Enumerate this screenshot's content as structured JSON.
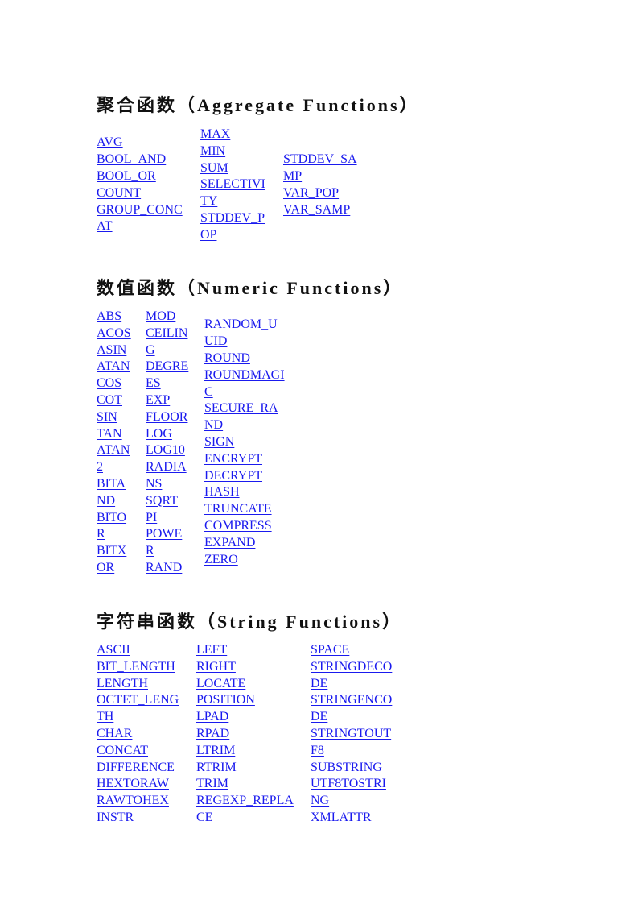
{
  "sections": [
    {
      "title": "聚合函数（Aggregate Functions）",
      "columns": [
        [
          "AVG",
          "BOOL_AND",
          "BOOL_OR",
          "COUNT",
          "GROUP_CONC",
          "AT"
        ],
        [
          "MAX",
          "MIN",
          "SUM",
          "SELECTIVI",
          "TY",
          "STDDEV_P",
          "OP"
        ],
        [
          "STDDEV_SA",
          "MP",
          "VAR_POP",
          "VAR_SAMP"
        ]
      ]
    },
    {
      "title": "数值函数（Numeric Functions）",
      "columns": [
        [
          "ABS",
          "ACOS",
          "ASIN",
          "ATAN",
          "COS",
          "COT",
          "SIN",
          "TAN",
          "ATAN",
          "2",
          "BITA",
          "ND",
          "BITO",
          "R",
          "BITX",
          "OR"
        ],
        [
          "MOD",
          "CEILIN",
          "G",
          "DEGRE",
          "ES",
          "EXP",
          "FLOOR",
          "LOG",
          "LOG10",
          "RADIA",
          "NS",
          "SQRT",
          "PI",
          "POWE",
          "R",
          "RAND"
        ],
        [
          "RANDOM_U",
          "UID",
          "ROUND",
          "ROUNDMAGI",
          "C",
          "SECURE_RA",
          "ND",
          "SIGN",
          "ENCRYPT",
          "DECRYPT",
          "HASH",
          "TRUNCATE",
          "COMPRESS",
          "EXPAND",
          "ZERO"
        ]
      ]
    },
    {
      "title": "字符串函数（String Functions）",
      "columns": [
        [
          "ASCII",
          "BIT_LENGTH",
          "LENGTH",
          "OCTET_LENG",
          "TH",
          "CHAR",
          "CONCAT",
          "DIFFERENCE",
          "HEXTORAW",
          "RAWTOHEX",
          "INSTR"
        ],
        [
          "LEFT",
          "RIGHT",
          "LOCATE",
          "POSITION",
          "LPAD",
          "RPAD",
          "LTRIM",
          "RTRIM",
          "TRIM",
          "REGEXP_REPLA",
          "CE"
        ],
        [
          "SPACE",
          "STRINGDECO",
          "DE",
          "STRINGENCO",
          "DE",
          "STRINGTOUT",
          "F8",
          "SUBSTRING",
          "UTF8TOSTRI",
          "NG",
          "XMLATTR"
        ]
      ]
    }
  ],
  "colors": {
    "link": "#1a1aee",
    "heading": "#111111"
  }
}
